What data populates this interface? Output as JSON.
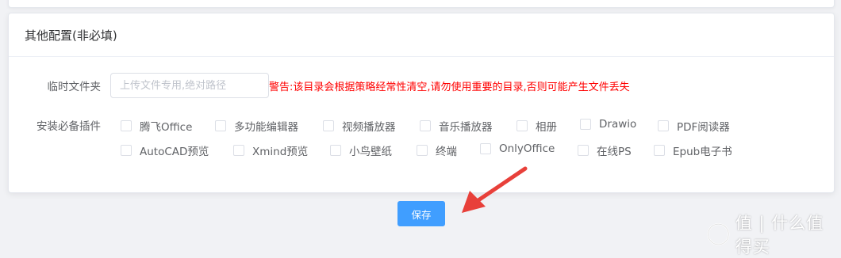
{
  "section": {
    "title": "其他配置(非必填)"
  },
  "temp_folder": {
    "label": "临时文件夹",
    "value": "",
    "placeholder": "上传文件专用,绝对路径",
    "warning": "警告:该目录会根据策略经常性清空,请勿使用重要的目录,否则可能产生文件丢失"
  },
  "plugins": {
    "label": "安装必备插件",
    "row1": [
      {
        "label": "腾飞Office",
        "checked": false
      },
      {
        "label": "多功能编辑器",
        "checked": false
      },
      {
        "label": "视频播放器",
        "checked": false
      },
      {
        "label": "音乐播放器",
        "checked": false
      },
      {
        "label": "相册",
        "checked": false
      },
      {
        "label": "Drawio",
        "checked": false
      },
      {
        "label": "PDF阅读器",
        "checked": false
      }
    ],
    "row2": [
      {
        "label": "AutoCAD预览",
        "checked": false
      },
      {
        "label": "Xmind预览",
        "checked": false
      },
      {
        "label": "小鸟壁纸",
        "checked": false
      },
      {
        "label": "终端",
        "checked": false
      },
      {
        "label": "OnlyOffice",
        "checked": false
      },
      {
        "label": "在线PS",
        "checked": false
      },
      {
        "label": "Epub电子书",
        "checked": false
      }
    ]
  },
  "actions": {
    "save_label": "保存"
  },
  "annotation": {
    "arrow_color": "#e8403a"
  },
  "watermark": {
    "text": "值 | 什么值得买"
  },
  "colors": {
    "primary": "#409eff",
    "warning": "#ff0000"
  }
}
